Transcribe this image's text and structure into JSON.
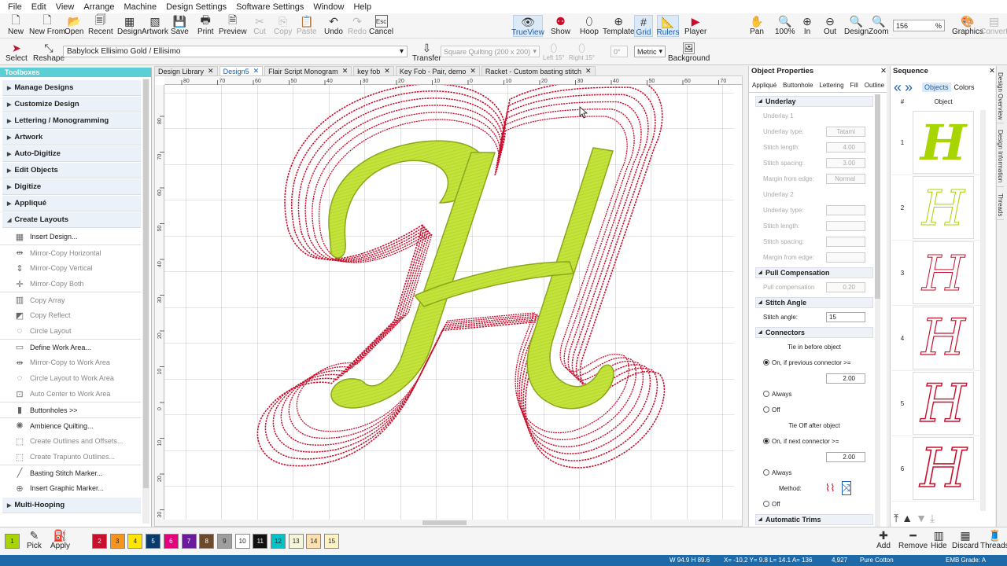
{
  "menu": [
    "File",
    "Edit",
    "View",
    "Arrange",
    "Machine",
    "Design Settings",
    "Software Settings",
    "Window",
    "Help"
  ],
  "toolbar": {
    "new": "New",
    "new_from": "New From",
    "open": "Open",
    "recent": "Recent",
    "design": "Design",
    "artwork": "Artwork",
    "save": "Save",
    "print": "Print",
    "preview": "Preview",
    "cut": "Cut",
    "copy": "Copy",
    "paste": "Paste",
    "undo": "Undo",
    "redo": "Redo",
    "cancel": "Cancel",
    "trueview": "TrueView",
    "show": "Show",
    "hoop": "Hoop",
    "template": "Template",
    "grid": "Grid",
    "rulers": "Rulers",
    "player": "Player",
    "pan": "Pan",
    "zoom100": "100%",
    "in": "In",
    "out": "Out",
    "design_zoom": "Design",
    "zoom": "Zoom",
    "zoom_value": "156",
    "zoom_unit": "%",
    "graphics": "Graphics",
    "convert": "Convert",
    "esc": "Esc"
  },
  "toolbar2": {
    "select": "Select",
    "reshape": "Reshape",
    "font": "Babylock Ellisimo Gold / Ellisimo",
    "transfer": "Transfer",
    "quilting": "Square Quilting (200 x 200)",
    "left15": "Left 15°",
    "right15": "Right 15°",
    "angle": "0°",
    "units": "Metric",
    "background": "Background"
  },
  "toolboxes": {
    "title": "Toolboxes",
    "sections": [
      "Manage Designs",
      "Customize Design",
      "Lettering / Monogramming",
      "Artwork",
      "Auto-Digitize",
      "Edit Objects",
      "Digitize",
      "Appliqué",
      "Create Layouts"
    ],
    "tools": [
      "Insert Design...",
      "Mirror-Copy Horizontal",
      "Mirror-Copy Vertical",
      "Mirror-Copy Both",
      "Copy Array",
      "Copy Reflect",
      "Circle Layout",
      "Define Work Area...",
      "Mirror-Copy to Work Area",
      "Circle Layout to Work Area",
      "Auto Center to Work Area",
      "Buttonholes >>",
      "Ambience Quilting...",
      "Create Outlines and Offsets...",
      "Create Trapunto Outlines...",
      "Basting Stitch Marker...",
      "Insert Graphic Marker..."
    ],
    "last_section": "Multi-Hooping"
  },
  "tabs": [
    "Design Library",
    "Design5",
    "Flair Script Monogram",
    "key fob",
    "Key Fob - Pair, demo",
    "Racket - Custom basting stitch"
  ],
  "ruler_h": [
    "80",
    "70",
    "60",
    "50",
    "40",
    "30",
    "20",
    "10",
    "0",
    "10",
    "20",
    "30",
    "40",
    "50",
    "60",
    "70"
  ],
  "ruler_v": [
    "80",
    "70",
    "60",
    "50",
    "40",
    "30",
    "20",
    "10",
    "0",
    "10",
    "20",
    "30"
  ],
  "objprops": {
    "title": "Object Properties",
    "tabs": [
      "Appliqué",
      "Buttonhole",
      "Lettering",
      "Fill",
      "Outline"
    ],
    "underlay": "Underlay",
    "underlay1": "Underlay 1",
    "underlay_type": "Underlay type:",
    "underlay_type_val": "Tatami",
    "stitch_length": "Stitch length:",
    "stitch_length_val": "4.00",
    "stitch_spacing": "Stitch spacing:",
    "stitch_spacing_val": "3.00",
    "margin": "Margin from edge:",
    "margin_val": "Normal",
    "underlay2": "Underlay 2",
    "pull_comp": "Pull Compensation",
    "pull_comp_label": "Pull compensation",
    "pull_comp_val": "0.20",
    "stitch_angle": "Stitch Angle",
    "stitch_angle_label": "Stitch angle:",
    "stitch_angle_val": "15",
    "connectors": "Connectors",
    "tie_in": "Tie in before object",
    "on_prev": "On, if previous connector >=",
    "tie_in_val": "2.00",
    "always": "Always",
    "off": "Off",
    "tie_off": "Tie Off after object",
    "on_next": "On, if next connector >=",
    "tie_off_val": "2.00",
    "method": "Method:",
    "auto_trims": "Automatic Trims",
    "unit_m": "m"
  },
  "sequence": {
    "title": "Sequence",
    "objects": "Objects",
    "colors": "Colors",
    "hash": "#",
    "object": "Object",
    "rows": [
      "1",
      "2",
      "3",
      "4",
      "5",
      "6"
    ]
  },
  "sidetabs": [
    "Design Overview",
    "Design Information",
    "Threads"
  ],
  "colorbar": {
    "pick": "Pick",
    "apply": "Apply",
    "swatches": [
      {
        "n": "1",
        "c": "#a8d400"
      },
      {
        "n": "2",
        "c": "#c8102e"
      },
      {
        "n": "3",
        "c": "#f7941d"
      },
      {
        "n": "4",
        "c": "#ffe600"
      },
      {
        "n": "5",
        "c": "#0b3b6b"
      },
      {
        "n": "6",
        "c": "#e6007e"
      },
      {
        "n": "7",
        "c": "#6a1b9a"
      },
      {
        "n": "8",
        "c": "#6b4a2e"
      },
      {
        "n": "9",
        "c": "#9e9e9e"
      },
      {
        "n": "10",
        "c": "#ffffff"
      },
      {
        "n": "11",
        "c": "#111111"
      },
      {
        "n": "12",
        "c": "#00c2c7"
      },
      {
        "n": "13",
        "c": "#f5f5dc"
      },
      {
        "n": "14",
        "c": "#ffe0b2"
      },
      {
        "n": "15",
        "c": "#fff3c4"
      }
    ],
    "add": "Add",
    "remove": "Remove",
    "hide": "Hide",
    "discard": "Discard",
    "threads": "Threads"
  },
  "status": {
    "size": "W 94.9 H 89.6",
    "coords": "X= -10.2 Y= 9.8 L= 14.1 A= 136",
    "stitches": "4,927",
    "thread": "Pure Cotton",
    "grade": "EMB Grade: A"
  },
  "colors": {
    "accent": "#5bcfd6",
    "fill": "#c4e33a",
    "outline": "#c8102e",
    "status": "#1e6aa8"
  }
}
